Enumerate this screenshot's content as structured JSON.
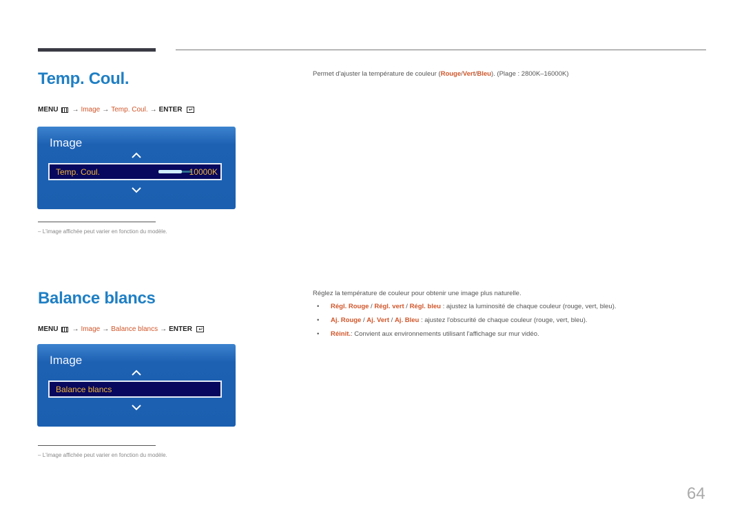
{
  "page_number": "64",
  "sections": [
    {
      "title": "Temp. Coul.",
      "menu_path": {
        "menu": "MENU",
        "menu_icon": "menu-grid-icon",
        "arrow": "→",
        "items": [
          "Image",
          "Temp. Coul."
        ],
        "enter": "ENTER",
        "enter_icon": "enter-return-icon"
      },
      "osd": {
        "title": "Image",
        "up_icon": "chevron-up-icon",
        "down_icon": "chevron-down-icon",
        "selected_item": "Temp. Coul.",
        "value": "10000K",
        "slider_fill_percent": 70
      },
      "note": "L'image affichée peut varier en fonction du modèle.",
      "note_dash": "–",
      "description": {
        "before": "Permet d'ajuster la température de couleur (",
        "hl1": "Rouge",
        "sep1": "/",
        "hl2": "Vert",
        "sep2": "/",
        "hl3": "Bleu",
        "after": "). (Plage : 2800K–16000K)"
      }
    },
    {
      "title": "Balance blancs",
      "menu_path": {
        "menu": "MENU",
        "menu_icon": "menu-grid-icon",
        "arrow": "→",
        "items": [
          "Image",
          "Balance blancs"
        ],
        "enter": "ENTER",
        "enter_icon": "enter-return-icon"
      },
      "osd": {
        "title": "Image",
        "up_icon": "chevron-up-icon",
        "down_icon": "chevron-down-icon",
        "selected_item": "Balance blancs"
      },
      "note": "L'image affichée peut varier en fonction du modèle.",
      "note_dash": "–",
      "description": "Réglez la température de couleur pour obtenir une image plus naturelle.",
      "bullets": [
        {
          "bullet": "•",
          "terms": [
            "Régl. Rouge",
            "Régl. vert",
            "Régl. bleu"
          ],
          "sep": " / ",
          "text": " : ajustez la luminosité de chaque couleur (rouge, vert, bleu)."
        },
        {
          "bullet": "•",
          "terms": [
            "Aj. Rouge",
            "Aj. Vert",
            "Aj. Bleu"
          ],
          "sep": " / ",
          "text": " : ajustez l'obscurité de chaque couleur (rouge, vert, bleu)."
        },
        {
          "bullet": "•",
          "terms": [
            "Réinit."
          ],
          "sep": "",
          "text": ": Convient aux environnements utilisant l'affichage sur mur vidéo."
        }
      ]
    }
  ],
  "colors": {
    "title_blue": "#1f7fc4",
    "highlight_orange": "#d0562a",
    "osd_blue": "#1b5fb0",
    "osd_selected_bg": "#07085e",
    "osd_selected_text": "#f3b63a"
  }
}
